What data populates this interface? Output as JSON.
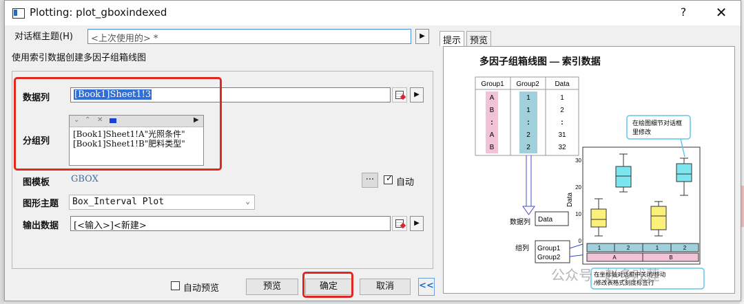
{
  "window": {
    "title": "Plotting: plot_gboxindexed",
    "help": "?",
    "close": "✕"
  },
  "theme": {
    "label": "对话框主题(H)",
    "value": "<上次使用的> *"
  },
  "description": "使用索引数据创建多因子组箱线图",
  "data_col": {
    "label": "数据列",
    "value": "[Book1]Sheet1!3"
  },
  "group_col": {
    "label": "分组列",
    "items": [
      "[Book1]Sheet1!A\"光照条件\"",
      "[Book1]Sheet1!B\"肥料类型\""
    ]
  },
  "template": {
    "label": "图模板",
    "value": "GBOX",
    "auto_label": "自动",
    "more": "···"
  },
  "graph_theme": {
    "label": "图形主题",
    "value": "Box_Interval Plot"
  },
  "output": {
    "label": "输出数据",
    "value": "[<输入>]<新建>"
  },
  "footer": {
    "auto_preview": "自动预览",
    "preview": "预览",
    "ok": "确定",
    "cancel": "取消",
    "collapse": "<<"
  },
  "tabs": [
    "提示",
    "预览"
  ],
  "hint": {
    "title": "多因子组箱线图 — 索引数据",
    "table_headers": [
      "Group1",
      "Group2",
      "Data"
    ],
    "table_rows": [
      [
        "A",
        "1",
        "1"
      ],
      [
        "B",
        "1",
        "2"
      ],
      [
        ":",
        ":",
        ":"
      ],
      [
        "A",
        "2",
        "31"
      ],
      [
        "B",
        "2",
        "32"
      ]
    ],
    "label_data": "数据列",
    "box_data": "Data",
    "label_group": "组列",
    "box_group1": "Group1",
    "box_group2": "Group2",
    "callout_top": "在绘图细节对话框里修改",
    "callout_bottom": "在坐标轴对话框中关闭/移动/修改表格式刻度标签行",
    "y_axis_title": "Data",
    "y_ticks": [
      "30",
      "20",
      "10",
      "0"
    ],
    "x_row1": [
      "1",
      "2",
      "1",
      "2"
    ],
    "x_row2": [
      "A",
      "B"
    ]
  },
  "watermark": "公众号 · 赵多戏莲"
}
